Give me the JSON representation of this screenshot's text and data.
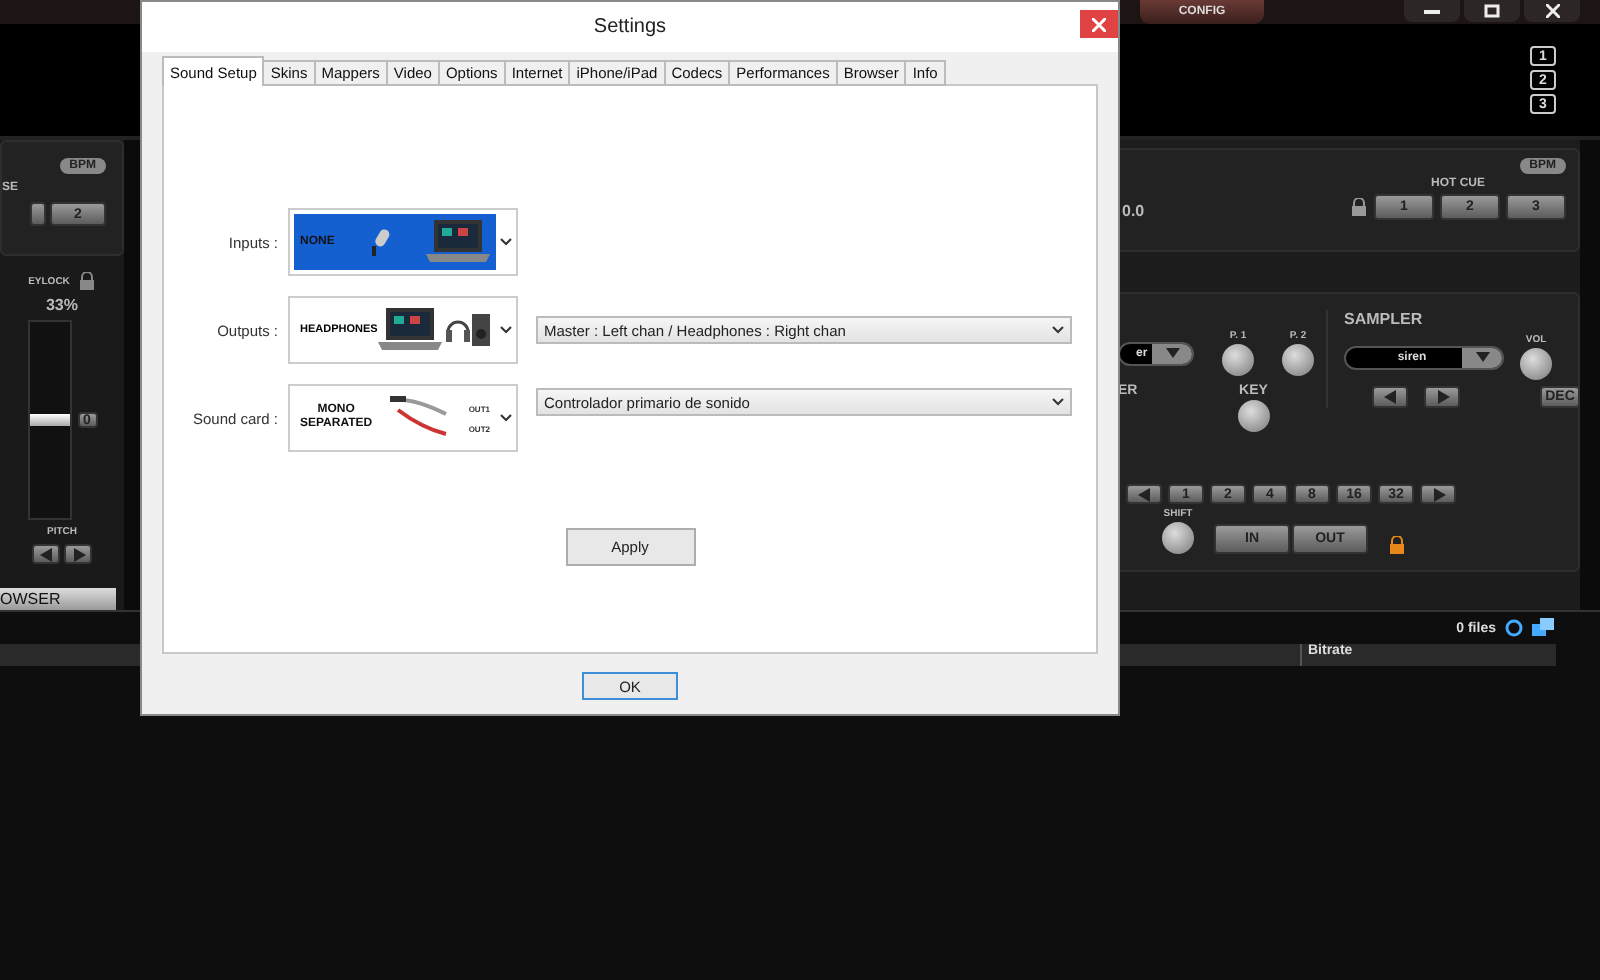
{
  "app": {
    "config": "CONFIG",
    "deck_numbers": [
      "1",
      "2",
      "3"
    ],
    "left_deck": {
      "bpm": "BPM",
      "label": "SE",
      "button": "2",
      "keylock": "EYLOCK",
      "pitch_value": "33%",
      "zero": "0",
      "pitch": "PITCH"
    },
    "right_deck": {
      "bpm": "BPM",
      "hot_cue_label": "HOT CUE",
      "hot_cues": [
        "1",
        "2",
        "3"
      ],
      "reading": "0.0"
    },
    "effects": {
      "effect": "er",
      "p1": "P. 1",
      "p2": "P. 2",
      "label": "ER",
      "key": "KEY"
    },
    "sampler": {
      "title": "SAMPLER",
      "sample": "siren",
      "vol": "VOL",
      "dec": "DEC"
    },
    "loop": {
      "sizes": [
        "1",
        "2",
        "4",
        "8",
        "16",
        "32"
      ],
      "shift": "SHIFT",
      "in": "IN",
      "out": "OUT"
    },
    "browser": {
      "tab": "OWSER",
      "count": "0 files",
      "columns": [
        "Bitrate"
      ]
    }
  },
  "dialog": {
    "title": "Settings",
    "tabs": [
      {
        "label": "Sound Setup",
        "selected": true
      },
      {
        "label": "Skins",
        "selected": false
      },
      {
        "label": "Mappers",
        "selected": false
      },
      {
        "label": "Video",
        "selected": false
      },
      {
        "label": "Options",
        "selected": false
      },
      {
        "label": "Internet",
        "selected": false
      },
      {
        "label": "iPhone/iPad",
        "selected": false
      },
      {
        "label": "Codecs",
        "selected": false
      },
      {
        "label": "Performances",
        "selected": false
      },
      {
        "label": "Browser",
        "selected": false
      },
      {
        "label": "Info",
        "selected": false
      }
    ],
    "rows": [
      {
        "label": "Inputs :",
        "picker": {
          "kind": "none",
          "caption": [
            "NONE"
          ]
        }
      },
      {
        "label": "Outputs :",
        "picker": {
          "kind": "headphones",
          "caption": [
            "HEADPHONES"
          ]
        },
        "value": "Master : Left chan / Headphones : Right chan"
      },
      {
        "label": "Sound card :",
        "picker": {
          "kind": "cables",
          "caption": [
            "MONO",
            "SEPARATED"
          ],
          "ports": [
            "OUT1",
            "OUT2"
          ]
        },
        "value": "Controlador primario de sonido"
      }
    ],
    "apply": "Apply",
    "ok": "OK"
  }
}
